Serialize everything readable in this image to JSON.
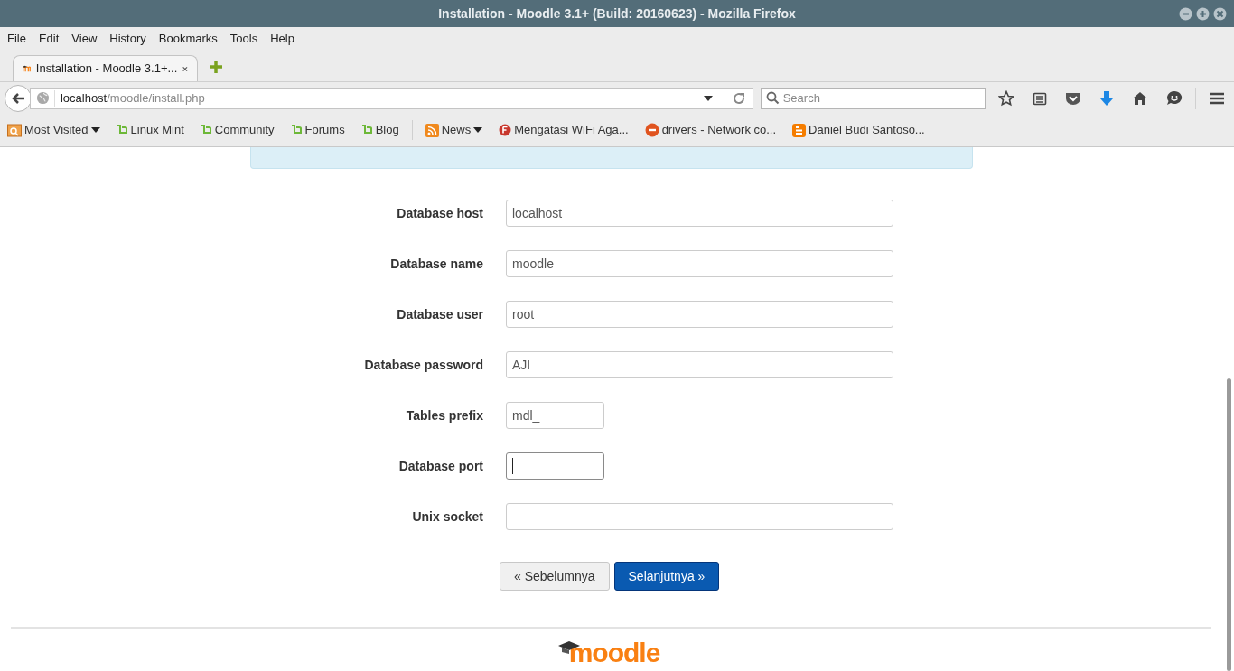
{
  "window": {
    "title": "Installation - Moodle 3.1+ (Build: 20160623) - Mozilla Firefox"
  },
  "menu": [
    "File",
    "Edit",
    "View",
    "History",
    "Bookmarks",
    "Tools",
    "Help"
  ],
  "tabs": [
    {
      "label": "Installation - Moodle 3.1+...",
      "selected": true
    }
  ],
  "address": {
    "host": "localhost",
    "path": "/moodle/install.php"
  },
  "search": {
    "placeholder": "Search"
  },
  "bookmarks": [
    {
      "label": "Most Visited",
      "kind": "folder",
      "dropdown": true
    },
    {
      "label": "Linux Mint",
      "kind": "mint",
      "dropdown": false
    },
    {
      "label": "Community",
      "kind": "mint",
      "dropdown": false
    },
    {
      "label": "Forums",
      "kind": "mint",
      "dropdown": false
    },
    {
      "label": "Blog",
      "kind": "mint",
      "dropdown": false
    },
    {
      "label": "News",
      "kind": "rss",
      "dropdown": true
    },
    {
      "label": "Mengatasi WiFi Aga...",
      "kind": "round-red",
      "dropdown": false
    },
    {
      "label": "drivers - Network co...",
      "kind": "ask",
      "dropdown": false
    },
    {
      "label": "Daniel Budi Santoso...",
      "kind": "blogger",
      "dropdown": false
    }
  ],
  "form": {
    "fields": [
      {
        "label": "Database host",
        "value": "localhost",
        "kind": "wide",
        "focused": false
      },
      {
        "label": "Database name",
        "value": "moodle",
        "kind": "wide",
        "focused": false
      },
      {
        "label": "Database user",
        "value": "root",
        "kind": "wide",
        "focused": false
      },
      {
        "label": "Database password",
        "value": "AJI",
        "kind": "wide",
        "focused": false
      },
      {
        "label": "Tables prefix",
        "value": "mdl_",
        "kind": "short",
        "focused": false
      },
      {
        "label": "Database port",
        "kind": "short",
        "focused": true
      },
      {
        "label": "Unix socket",
        "kind": "wide",
        "focused": false
      }
    ],
    "buttons": [
      {
        "label": "« Sebelumnya",
        "kind": "secondary"
      },
      {
        "label": "Selanjutnya »",
        "kind": "primary"
      }
    ]
  },
  "footer": {
    "logo": "moodle"
  }
}
